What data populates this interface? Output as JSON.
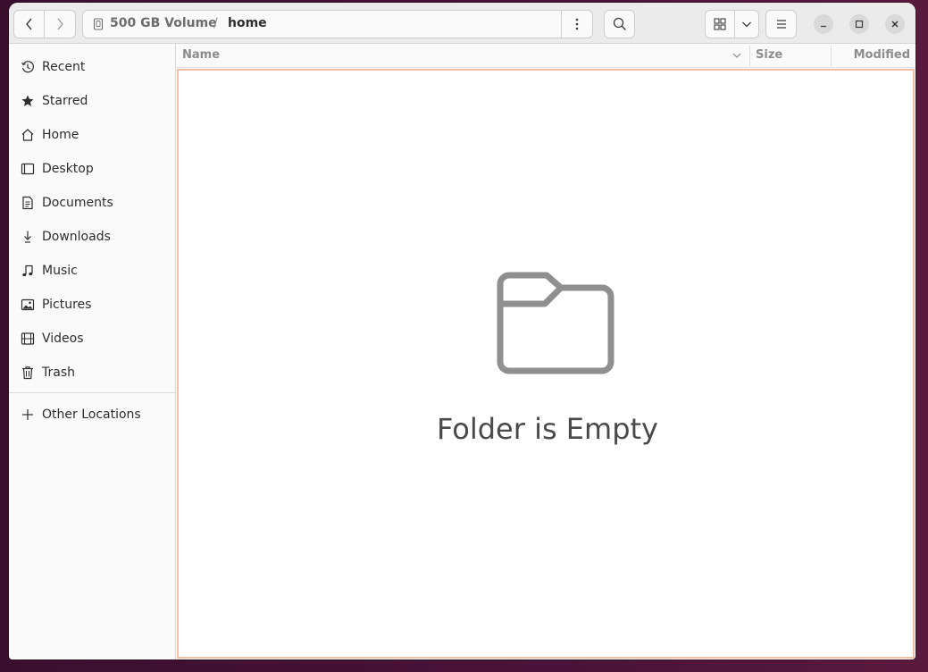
{
  "window": {
    "path": {
      "drive_label": "500 GB Volume",
      "separator": "/",
      "current_folder": "home"
    }
  },
  "icons": {
    "back": "chevron-left-icon",
    "forward": "chevron-right-icon",
    "drive": "drive-icon",
    "path_menu": "vertical-dots-icon",
    "search": "search-icon",
    "grid_view": "grid-icon",
    "view_dropdown": "chevron-down-icon",
    "main_menu": "hamburger-icon",
    "minimize": "minimize-icon",
    "maximize": "maximize-icon",
    "close": "close-icon"
  },
  "sidebar": {
    "items": [
      {
        "label": "Recent",
        "icon": "clock-icon"
      },
      {
        "label": "Starred",
        "icon": "star-icon"
      },
      {
        "label": "Home",
        "icon": "home-icon"
      },
      {
        "label": "Desktop",
        "icon": "desktop-icon"
      },
      {
        "label": "Documents",
        "icon": "document-icon"
      },
      {
        "label": "Downloads",
        "icon": "download-icon"
      },
      {
        "label": "Music",
        "icon": "music-icon"
      },
      {
        "label": "Pictures",
        "icon": "picture-icon"
      },
      {
        "label": "Videos",
        "icon": "video-icon"
      },
      {
        "label": "Trash",
        "icon": "trash-icon"
      }
    ],
    "other_locations": {
      "label": "Other Locations",
      "icon": "plus-icon"
    }
  },
  "columns": {
    "name": "Name",
    "size": "Size",
    "modified": "Modified"
  },
  "empty_state": {
    "message": "Folder is Empty",
    "icon": "folder-icon"
  },
  "colors": {
    "focus_border": "#f3bfa5",
    "desktop_bg": "#4a1238"
  }
}
